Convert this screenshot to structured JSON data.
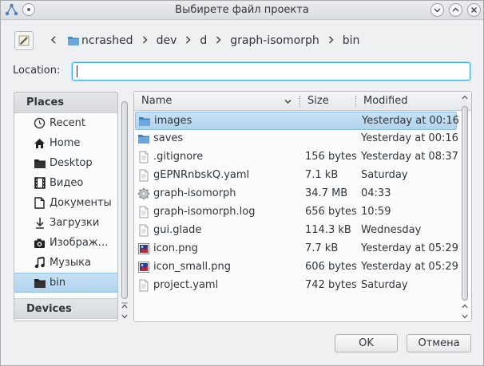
{
  "window": {
    "title": "Выбирете файл проекта"
  },
  "breadcrumb": {
    "items": [
      "ncrashed",
      "dev",
      "d",
      "graph-isomorph",
      "bin"
    ]
  },
  "location": {
    "label": "Location:",
    "value": ""
  },
  "places": {
    "section_label": "Places",
    "devices_label": "Devices",
    "items": [
      {
        "label": "Recent",
        "icon": "clock-icon"
      },
      {
        "label": "Home",
        "icon": "home-icon"
      },
      {
        "label": "Desktop",
        "icon": "desktop-folder-icon"
      },
      {
        "label": "Видео",
        "icon": "film-icon"
      },
      {
        "label": "Документы",
        "icon": "document-icon"
      },
      {
        "label": "Загрузки",
        "icon": "download-icon"
      },
      {
        "label": "Изображ…",
        "icon": "camera-icon"
      },
      {
        "label": "Музыка",
        "icon": "music-icon"
      },
      {
        "label": "bin",
        "icon": "folder-icon"
      }
    ]
  },
  "file_list": {
    "columns": {
      "name": "Name",
      "size": "Size",
      "modified": "Modified"
    },
    "rows": [
      {
        "name": "images",
        "size": "",
        "modified": "Yesterday at 00:16",
        "icon": "folder-icon"
      },
      {
        "name": "saves",
        "size": "",
        "modified": "Yesterday at 00:16",
        "icon": "folder-icon"
      },
      {
        "name": ".gitignore",
        "size": "156 bytes",
        "modified": "Yesterday at 08:37",
        "icon": "text-file-icon"
      },
      {
        "name": "gEPNRnbskQ.yaml",
        "size": "7.1 kB",
        "modified": "Saturday",
        "icon": "text-file-icon"
      },
      {
        "name": "graph-isomorph",
        "size": "34.7 MB",
        "modified": "04:33",
        "icon": "executable-gear-icon"
      },
      {
        "name": "graph-isomorph.log",
        "size": "656 bytes",
        "modified": "10:59",
        "icon": "text-file-icon"
      },
      {
        "name": "gui.glade",
        "size": "114.3 kB",
        "modified": "Wednesday",
        "icon": "text-file-icon"
      },
      {
        "name": "icon.png",
        "size": "7.7 kB",
        "modified": "Yesterday at 05:29",
        "icon": "image-file-icon"
      },
      {
        "name": "icon_small.png",
        "size": "606 bytes",
        "modified": "Yesterday at 05:29",
        "icon": "image-file-icon"
      },
      {
        "name": "project.yaml",
        "size": "742 bytes",
        "modified": "Saturday",
        "icon": "text-file-icon"
      }
    ]
  },
  "buttons": {
    "ok": "OK",
    "cancel": "Отмена"
  },
  "colors": {
    "selection": "#b1d4ee",
    "accent": "#3daee9",
    "folder": "#4a8cc8"
  }
}
